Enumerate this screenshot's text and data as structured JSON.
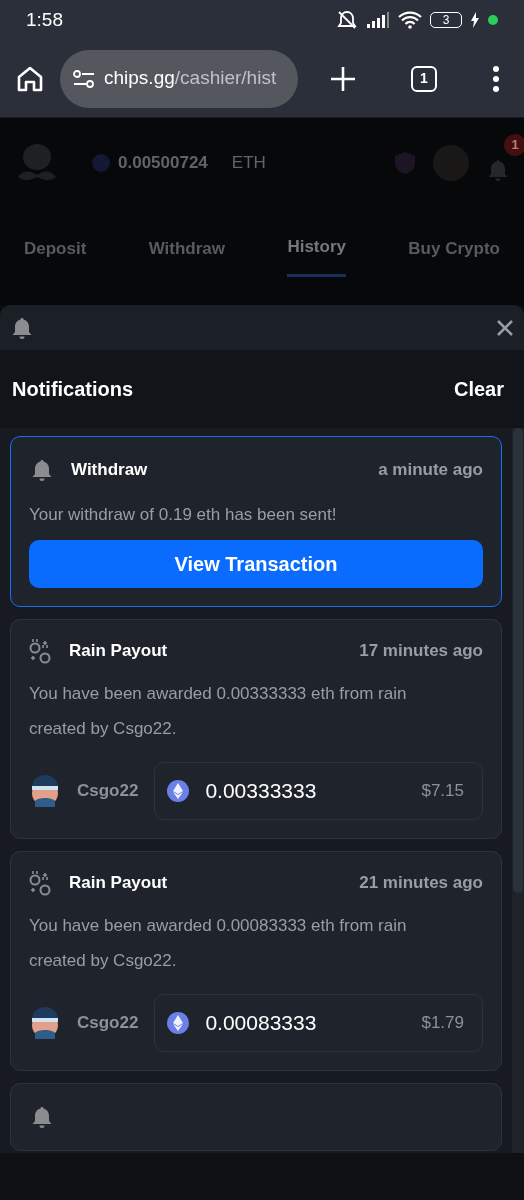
{
  "status_bar": {
    "time": "1:58",
    "battery": "3"
  },
  "browser": {
    "url_host": "chips.gg",
    "url_path": "/cashier/hist",
    "tab_count": "1"
  },
  "site_header": {
    "balance": "0.00500724",
    "currency": "ETH",
    "notification_count": "1"
  },
  "cashier_tabs": [
    {
      "label": "Deposit",
      "selected": false
    },
    {
      "label": "Withdraw",
      "selected": false
    },
    {
      "label": "History",
      "selected": true
    },
    {
      "label": "Buy Crypto",
      "selected": false
    }
  ],
  "notifications": {
    "title": "Notifications",
    "clear": "Clear",
    "items": [
      {
        "kind": "withdraw",
        "highlighted": true,
        "title": "Withdraw",
        "time": "a minute ago",
        "message": "Your withdraw of 0.19 eth has been sent!",
        "button": "View Transaction"
      },
      {
        "kind": "rain",
        "highlighted": false,
        "title": "Rain Payout",
        "time": "17 minutes ago",
        "message": "You have been awarded 0.00333333 eth from rain created by Csgo22.",
        "user": "Csgo22",
        "amount": "0.00333333",
        "usd": "$7.15"
      },
      {
        "kind": "rain",
        "highlighted": false,
        "title": "Rain Payout",
        "time": "21 minutes ago",
        "message": "You have been awarded 0.00083333 eth from rain created by Csgo22.",
        "user": "Csgo22",
        "amount": "0.00083333",
        "usd": "$1.79"
      },
      {
        "kind": "bell",
        "highlighted": false
      }
    ]
  }
}
